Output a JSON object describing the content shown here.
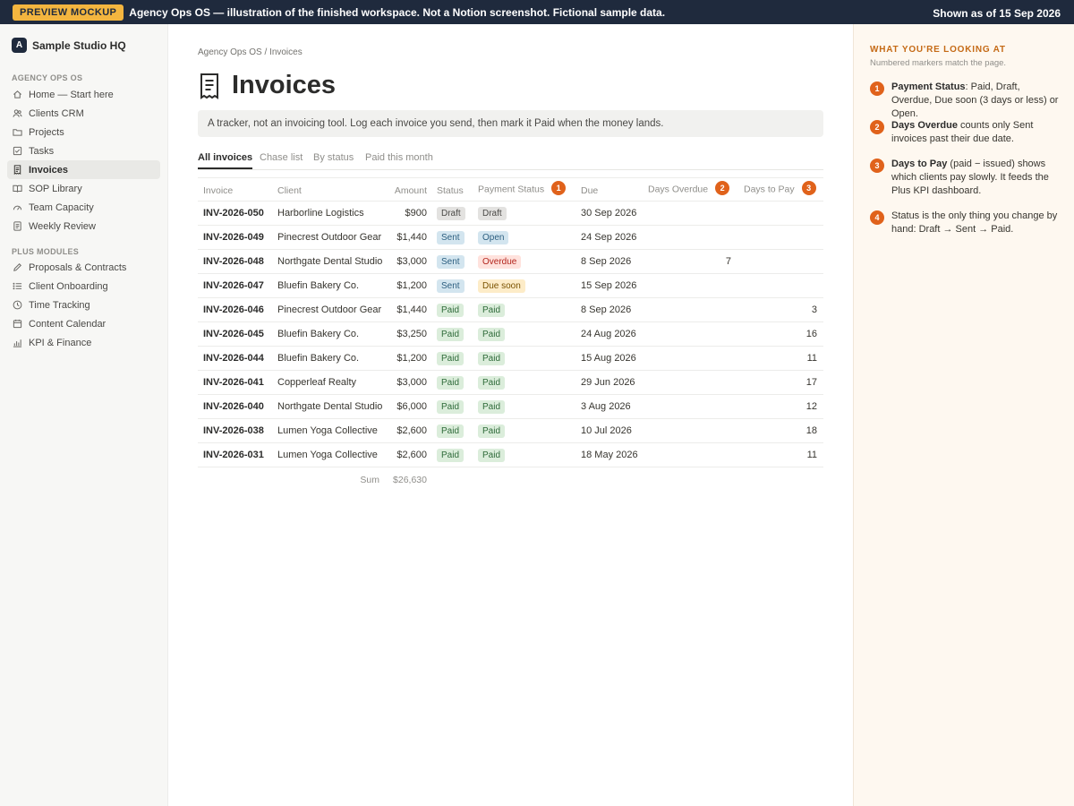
{
  "banner": {
    "badge": "PREVIEW MOCKUP",
    "message": "Agency Ops OS — illustration of the finished workspace. Not a Notion screenshot. Fictional sample data.",
    "as_of": "Shown as of 15 Sep 2026"
  },
  "sidebar": {
    "workspace_initial": "A",
    "workspace_name": "Sample Studio HQ",
    "section1_label": "AGENCY OPS OS",
    "items": [
      {
        "label": "Home — Start here",
        "icon": "home-icon"
      },
      {
        "label": "Clients CRM",
        "icon": "people-icon"
      },
      {
        "label": "Projects",
        "icon": "folder-icon"
      },
      {
        "label": "Tasks",
        "icon": "checkbox-icon"
      },
      {
        "label": "Invoices",
        "icon": "receipt-icon"
      },
      {
        "label": "SOP Library",
        "icon": "book-icon"
      },
      {
        "label": "Team Capacity",
        "icon": "gauge-icon"
      },
      {
        "label": "Weekly Review",
        "icon": "document-icon"
      }
    ],
    "section2_label": "PLUS MODULES",
    "plus_items": [
      {
        "label": "Proposals & Contracts",
        "icon": "pen-icon"
      },
      {
        "label": "Client Onboarding",
        "icon": "list-icon"
      },
      {
        "label": "Time Tracking",
        "icon": "clock-icon"
      },
      {
        "label": "Content Calendar",
        "icon": "calendar-icon"
      },
      {
        "label": "KPI & Finance",
        "icon": "bar-chart-icon"
      }
    ]
  },
  "page": {
    "breadcrumb": "Agency Ops OS / Invoices",
    "title": "Invoices",
    "title_icon": "receipt-icon",
    "callout": "A tracker, not an invoicing tool. Log each invoice you send, then mark it Paid when the money lands.",
    "tabs": [
      "All invoices",
      "Chase list",
      "By status",
      "Paid this month"
    ]
  },
  "table": {
    "columns": {
      "invoice": "Invoice",
      "client": "Client",
      "amount": "Amount",
      "status": "Status",
      "payment_status": "Payment Status",
      "due": "Due",
      "days_overdue": "Days Overdue",
      "days_to_pay": "Days to Pay"
    },
    "markers": {
      "payment_status": "1",
      "days_overdue": "2",
      "days_to_pay": "3"
    },
    "rows": [
      {
        "invoice": "INV-2026-050",
        "client": "Harborline Logistics",
        "amount": "$900",
        "status": "Draft",
        "payment_status": "Draft",
        "due": "30 Sep 2026",
        "days_overdue": "",
        "days_to_pay": ""
      },
      {
        "invoice": "INV-2026-049",
        "client": "Pinecrest Outdoor Gear",
        "amount": "$1,440",
        "status": "Sent",
        "payment_status": "Open",
        "due": "24 Sep 2026",
        "days_overdue": "",
        "days_to_pay": ""
      },
      {
        "invoice": "INV-2026-048",
        "client": "Northgate Dental Studio",
        "amount": "$3,000",
        "status": "Sent",
        "payment_status": "Overdue",
        "due": "8 Sep 2026",
        "days_overdue": "7",
        "days_to_pay": ""
      },
      {
        "invoice": "INV-2026-047",
        "client": "Bluefin Bakery Co.",
        "amount": "$1,200",
        "status": "Sent",
        "payment_status": "Due soon",
        "due": "15 Sep 2026",
        "days_overdue": "",
        "days_to_pay": ""
      },
      {
        "invoice": "INV-2026-046",
        "client": "Pinecrest Outdoor Gear",
        "amount": "$1,440",
        "status": "Paid",
        "payment_status": "Paid",
        "due": "8 Sep 2026",
        "days_overdue": "",
        "days_to_pay": "3"
      },
      {
        "invoice": "INV-2026-045",
        "client": "Bluefin Bakery Co.",
        "amount": "$3,250",
        "status": "Paid",
        "payment_status": "Paid",
        "due": "24 Aug 2026",
        "days_overdue": "",
        "days_to_pay": "16"
      },
      {
        "invoice": "INV-2026-044",
        "client": "Bluefin Bakery Co.",
        "amount": "$1,200",
        "status": "Paid",
        "payment_status": "Paid",
        "due": "15 Aug 2026",
        "days_overdue": "",
        "days_to_pay": "11"
      },
      {
        "invoice": "INV-2026-041",
        "client": "Copperleaf Realty",
        "amount": "$3,000",
        "status": "Paid",
        "payment_status": "Paid",
        "due": "29 Jun 2026",
        "days_overdue": "",
        "days_to_pay": "17"
      },
      {
        "invoice": "INV-2026-040",
        "client": "Northgate Dental Studio",
        "amount": "$6,000",
        "status": "Paid",
        "payment_status": "Paid",
        "due": "3 Aug 2026",
        "days_overdue": "",
        "days_to_pay": "12"
      },
      {
        "invoice": "INV-2026-038",
        "client": "Lumen Yoga Collective",
        "amount": "$2,600",
        "status": "Paid",
        "payment_status": "Paid",
        "due": "10 Jul 2026",
        "days_overdue": "",
        "days_to_pay": "18"
      },
      {
        "invoice": "INV-2026-031",
        "client": "Lumen Yoga Collective",
        "amount": "$2,600",
        "status": "Paid",
        "payment_status": "Paid",
        "due": "18 May 2026",
        "days_overdue": "",
        "days_to_pay": "11"
      }
    ],
    "sum_label": "Sum",
    "sum_value": "$26,630"
  },
  "panel": {
    "heading": "WHAT YOU'RE LOOKING AT",
    "subheading": "Numbered markers match the page.",
    "notes": [
      {
        "num": "1",
        "bold": "Payment Status",
        "text": ": Paid, Draft, Overdue, Due soon (3 days or less) or Open."
      },
      {
        "num": "2",
        "bold": "Days Overdue",
        "text": " counts only Sent invoices past their due date."
      },
      {
        "num": "3",
        "bold": "Days to Pay",
        "text": " (paid − issued) shows which clients pay slowly. It feeds the Plus KPI dashboard."
      },
      {
        "num": "4",
        "bold": "",
        "text": "Status is the only thing you change by hand: Draft → Sent → Paid."
      }
    ]
  },
  "colors": {
    "banner_bg": "#1f2a3d",
    "badge_bg": "#f3b53f",
    "marker": "#e0621b",
    "panel_bg": "#fef8f0",
    "panel_heading": "#c56a16"
  }
}
